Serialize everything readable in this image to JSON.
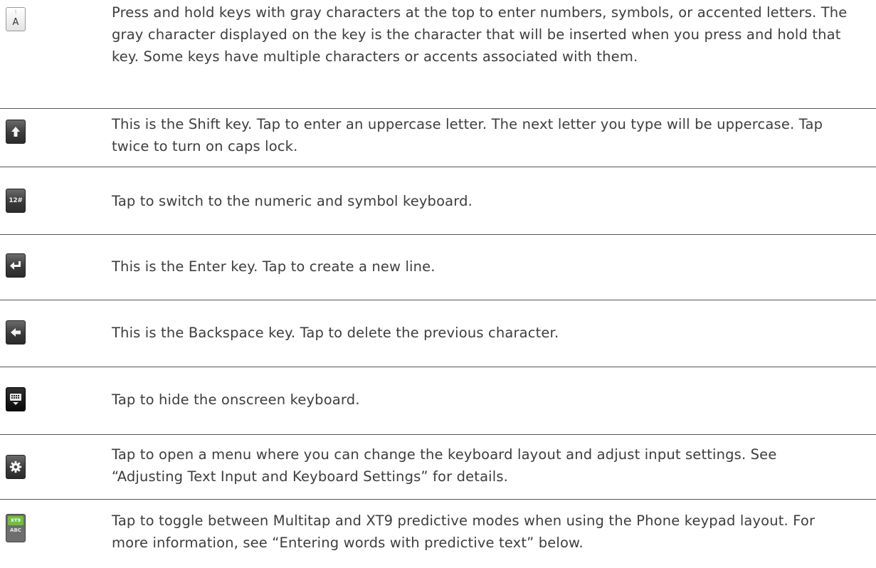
{
  "rows": [
    {
      "icon": "accent-key-icon",
      "icon_text": "A",
      "description": "Press and hold keys with gray characters at the top to enter numbers, symbols, or accented letters. The gray character displayed on the key is the character that will be inserted when you press and hold that key. Some keys have multiple characters or accents associated with them."
    },
    {
      "icon": "shift-key-icon",
      "description": "This is the Shift key. Tap to enter an uppercase letter. The next letter you type will be uppercase. Tap twice to turn on caps lock."
    },
    {
      "icon": "numeric-symbol-key-icon",
      "icon_text": "12#",
      "description": "Tap to switch to the numeric and symbol keyboard."
    },
    {
      "icon": "enter-key-icon",
      "description": "This is the Enter key. Tap to create a new line."
    },
    {
      "icon": "backspace-key-icon",
      "description": "This is the Backspace key. Tap to delete the previous character."
    },
    {
      "icon": "hide-keyboard-icon",
      "description": "Tap to hide the onscreen keyboard."
    },
    {
      "icon": "settings-gear-icon",
      "description": "Tap to open a menu where you can change the keyboard layout and adjust input settings. See “Adjusting Text Input and Keyboard Settings” for details."
    },
    {
      "icon": "xt9-abc-toggle-icon",
      "icon_text_top": "XT9",
      "icon_text_bottom": "ABC",
      "description": "Tap to toggle between Multitap and XT9 predictive modes when using the Phone keypad layout. For more information, see “Entering words with predictive text” below."
    }
  ]
}
